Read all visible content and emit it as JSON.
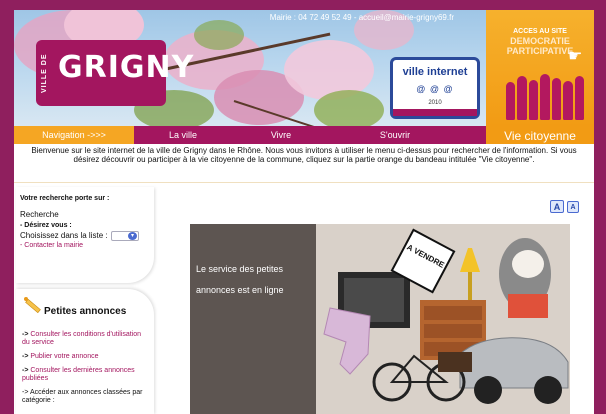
{
  "header": {
    "contact": "Mairie : 04 72 49 52 49 - accueil@mairie-grigny69.fr",
    "logo_prefix": "VILLE DE",
    "logo_name": "GRIGNY",
    "label_title": "ville internet",
    "label_icons": "@ @ @",
    "label_year": "2010",
    "democracy_line1": "ACCES AU SITE",
    "democracy_line2": "DEMOCRATIE",
    "democracy_line3": "PARTICIPATIVE"
  },
  "nav": {
    "items": [
      "Navigation ->>>",
      "La ville",
      "Vivre",
      "S'ouvrir"
    ],
    "citoyenne": "Vie citoyenne"
  },
  "welcome": "Bienvenue sur le site internet de la ville de Grigny dans le Rhône. Nous vous invitons à utiliser le menu ci-dessus pour rechercher de l'information. Si vous désirez découvrir ou participer à la vie citoyenne de la commune, cliquez sur la partie orange du bandeau intitulée \"Vie citoyenne\".",
  "search": {
    "label": "Votre recherche porte sur :",
    "value": "Recherche",
    "desirez": "- Désirez vous :",
    "choose_label": "Choisissez dans la liste :",
    "contact_link": "- Contacter la mairie"
  },
  "annonces": {
    "title": "Petites annonces",
    "links": [
      "Consulter les conditions d'utilisation du service",
      "Publier votre annonce",
      "Consulter les dernières annonces publiées"
    ],
    "arrow": "->",
    "access": "-> Accéder aux annonces classées par catégorie :"
  },
  "font_buttons": [
    "A",
    "A"
  ],
  "feature": {
    "line1": "Le service des petites",
    "line2": "annonces est en ligne",
    "sign": "A VENDRE"
  },
  "colors": {
    "brand": "#a3165f",
    "orange": "#f29b14",
    "link": "#a3165f"
  },
  "icons": [
    "pencil-icon",
    "cursor-icon",
    "select-arrow-icon"
  ]
}
